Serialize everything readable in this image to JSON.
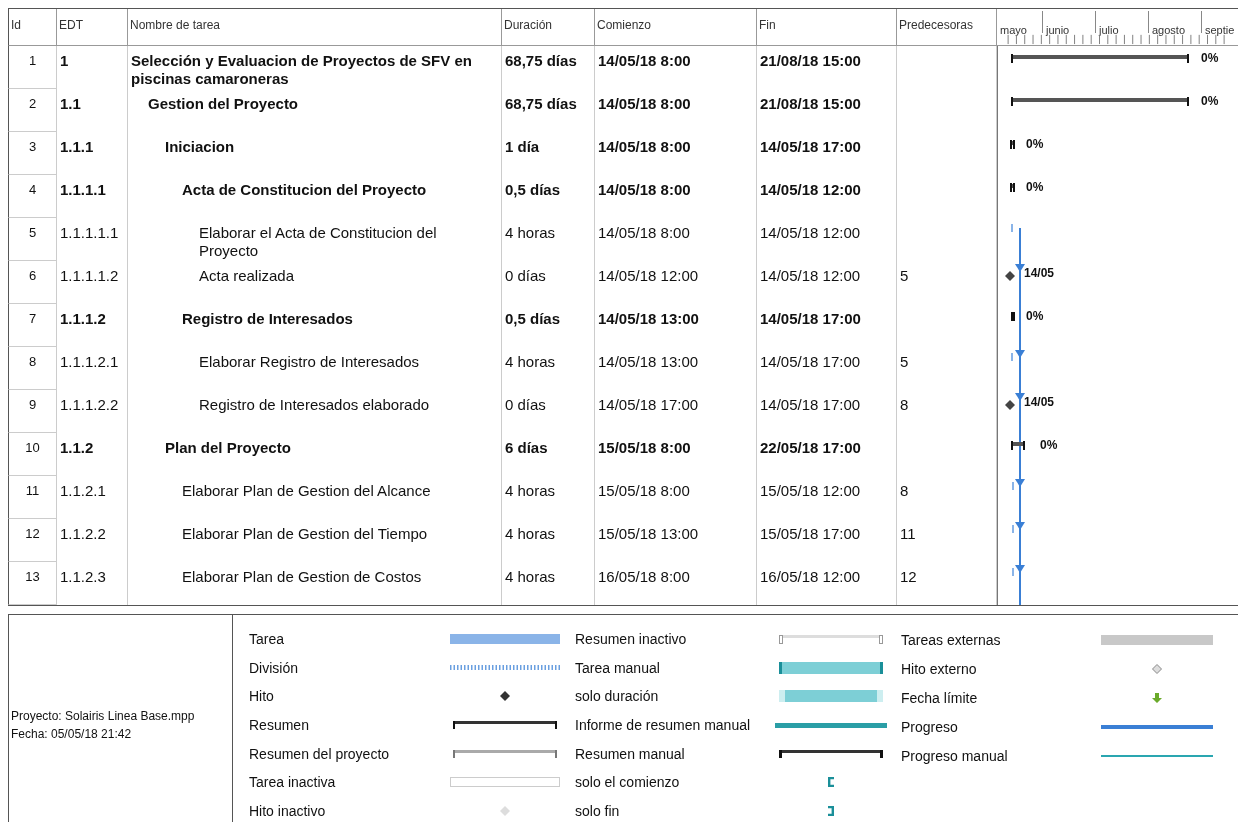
{
  "table": {
    "columns": [
      "Id",
      "EDT",
      "Nombre de tarea",
      "Duración",
      "Comienzo",
      "Fin",
      "Predecesoras"
    ],
    "timescale": {
      "months": [
        "mayo",
        "junio",
        "julio",
        "agosto",
        "septie"
      ]
    },
    "tasks": [
      {
        "id": "1",
        "edt": "1",
        "name": "Selección y Evaluacion de Proyectos de SFV en piscinas camaroneras",
        "duration": "68,75 días",
        "start": "14/05/18 8:00",
        "finish": "21/08/18 15:00",
        "summary": true,
        "bar": {
          "kind": "summary",
          "label": "0%"
        },
        "children": [
          {
            "id": "2",
            "edt": "1.1",
            "name": "Gestion del Proyecto",
            "duration": "68,75 días",
            "start": "14/05/18 8:00",
            "finish": "21/08/18 15:00",
            "summary": true,
            "bar": {
              "kind": "summary",
              "label": "0%"
            },
            "children": [
              {
                "id": "3",
                "edt": "1.1.1",
                "name": "Iniciacion",
                "duration": "1 día",
                "start": "14/05/18 8:00",
                "finish": "14/05/18 17:00",
                "summary": true,
                "bar": {
                  "kind": "summary",
                  "label": "0%"
                },
                "children": [
                  {
                    "id": "4",
                    "edt": "1.1.1.1",
                    "name": "Acta de Constitucion del Proyecto",
                    "duration": "0,5 días",
                    "start": "14/05/18 8:00",
                    "finish": "14/05/18 12:00",
                    "summary": true,
                    "bar": {
                      "kind": "summary",
                      "label": "0%"
                    },
                    "children": [
                      {
                        "id": "5",
                        "edt": "1.1.1.1.1",
                        "name": "Elaborar el Acta de Constitucion del Proyecto",
                        "duration": "4 horas",
                        "start": "14/05/18 8:00",
                        "finish": "14/05/18 12:00",
                        "summary": false,
                        "bar": {
                          "kind": "task"
                        }
                      },
                      {
                        "id": "6",
                        "edt": "1.1.1.1.2",
                        "name": "Acta realizada",
                        "duration": "0 días",
                        "start": "14/05/18 12:00",
                        "finish": "14/05/18 12:00",
                        "predecessors": "5",
                        "summary": false,
                        "bar": {
                          "kind": "milestone",
                          "label": "14/05"
                        }
                      }
                    ]
                  },
                  {
                    "id": "7",
                    "edt": "1.1.1.2",
                    "name": "Registro de Interesados",
                    "duration": "0,5 días",
                    "start": "14/05/18 13:00",
                    "finish": "14/05/18 17:00",
                    "summary": true,
                    "bar": {
                      "kind": "summary",
                      "label": "0%"
                    },
                    "children": [
                      {
                        "id": "8",
                        "edt": "1.1.1.2.1",
                        "name": "Elaborar Registro de Interesados",
                        "duration": "4 horas",
                        "start": "14/05/18 13:00",
                        "finish": "14/05/18 17:00",
                        "predecessors": "5",
                        "summary": false,
                        "bar": {
                          "kind": "task"
                        }
                      },
                      {
                        "id": "9",
                        "edt": "1.1.1.2.2",
                        "name": "Registro de Interesados elaborado",
                        "duration": "0 días",
                        "start": "14/05/18 17:00",
                        "finish": "14/05/18 17:00",
                        "predecessors": "8",
                        "summary": false,
                        "bar": {
                          "kind": "milestone",
                          "label": "14/05"
                        }
                      }
                    ]
                  }
                ]
              },
              {
                "id": "10",
                "edt": "1.1.2",
                "name": "Plan del Proyecto",
                "duration": "6 días",
                "start": "15/05/18 8:00",
                "finish": "22/05/18 17:00",
                "summary": true,
                "bar": {
                  "kind": "summary",
                  "label": "0%"
                },
                "children": [
                  {
                    "id": "11",
                    "edt": "1.1.2.1",
                    "name": "Elaborar Plan de Gestion del Alcance",
                    "duration": "4 horas",
                    "start": "15/05/18 8:00",
                    "finish": "15/05/18 12:00",
                    "predecessors": "8",
                    "summary": false,
                    "bar": {
                      "kind": "task"
                    }
                  },
                  {
                    "id": "12",
                    "edt": "1.1.2.2",
                    "name": "Elaborar Plan de Gestion del Tiempo",
                    "duration": "4 horas",
                    "start": "15/05/18 13:00",
                    "finish": "15/05/18 17:00",
                    "predecessors": "11",
                    "summary": false,
                    "bar": {
                      "kind": "task"
                    }
                  },
                  {
                    "id": "13",
                    "edt": "1.1.2.3",
                    "name": "Elaborar Plan de Gestion de Costos",
                    "duration": "4 horas",
                    "start": "16/05/18 8:00",
                    "finish": "16/05/18 12:00",
                    "predecessors": "12",
                    "summary": false,
                    "bar": {
                      "kind": "task"
                    }
                  }
                ]
              }
            ]
          }
        ]
      }
    ]
  },
  "legend": {
    "project": "Proyecto: Solairis Linea Base.mpp",
    "date": "Fecha: 05/05/18 21:42",
    "columns": [
      [
        {
          "label": "Tarea",
          "kind": "task"
        },
        {
          "label": "División",
          "kind": "split"
        },
        {
          "label": "Hito",
          "kind": "milestone"
        },
        {
          "label": "Resumen",
          "kind": "summary"
        },
        {
          "label": "Resumen del proyecto",
          "kind": "project-summary"
        },
        {
          "label": "Tarea inactiva",
          "kind": "inactive-task"
        },
        {
          "label": "Hito inactivo",
          "kind": "inactive-milestone"
        }
      ],
      [
        {
          "label": "Resumen inactivo",
          "kind": "inactive-summary"
        },
        {
          "label": "Tarea manual",
          "kind": "manual-task"
        },
        {
          "label": "solo duración",
          "kind": "duration-only"
        },
        {
          "label": "Informe de resumen manual",
          "kind": "manual-rollup"
        },
        {
          "label": "Resumen manual",
          "kind": "manual-summary"
        },
        {
          "label": "solo el comienzo",
          "kind": "start-only"
        },
        {
          "label": "solo fin",
          "kind": "finish-only"
        }
      ],
      [
        {
          "label": "Tareas externas",
          "kind": "external-tasks"
        },
        {
          "label": "Hito externo",
          "kind": "external-milestone"
        },
        {
          "label": "Fecha límite",
          "kind": "deadline"
        },
        {
          "label": "Progreso",
          "kind": "progress"
        },
        {
          "label": "Progreso manual",
          "kind": "manual-progress"
        }
      ]
    ]
  }
}
